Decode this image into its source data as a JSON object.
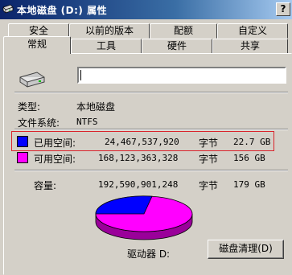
{
  "window": {
    "title": "本地磁盘 (D:) 属性",
    "help_button": "?"
  },
  "tabs_row1": [
    "安全",
    "以前的版本",
    "配额",
    "自定义"
  ],
  "tabs_row2": [
    "常规",
    "工具",
    "硬件",
    "共享"
  ],
  "active_tab": "常规",
  "general": {
    "drive_name_value": "",
    "type_label": "类型:",
    "type_value": "本地磁盘",
    "fs_label": "文件系统:",
    "fs_value": "NTFS",
    "used_label": "已用空间:",
    "used_bytes": "24,467,537,920",
    "used_unit": "字节",
    "used_size": "22.7 GB",
    "free_label": "可用空间:",
    "free_bytes": "168,123,363,328",
    "free_unit": "字节",
    "free_size": "156 GB",
    "capacity_label": "容量:",
    "capacity_bytes": "192,590,901,248",
    "capacity_unit": "字节",
    "capacity_size": "179 GB",
    "drive_label": "驱动器 D:",
    "cleanup_button": "磁盘清理(D)",
    "used_fraction": 0.127
  },
  "colors": {
    "used": "#0000ff",
    "free": "#ff00ff",
    "highlight": "#d9232b"
  },
  "icons": [
    "drive-icon",
    "hard-disk-icon"
  ]
}
